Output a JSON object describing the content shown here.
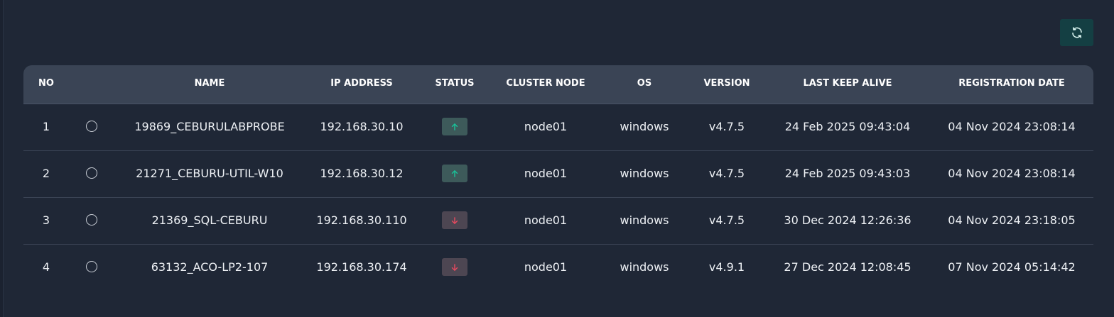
{
  "toolbar": {
    "refresh_icon": "refresh-icon",
    "accent": "#143f43"
  },
  "table": {
    "headers": {
      "no": "NO",
      "name": "NAME",
      "ip": "IP ADDRESS",
      "status": "STATUS",
      "cluster_node": "CLUSTER NODE",
      "os": "OS",
      "version": "VERSION",
      "last_keep_alive": "LAST KEEP ALIVE",
      "registration_date": "REGISTRATION DATE"
    },
    "rows": [
      {
        "no": "1",
        "name": "19869_CEBURULABPROBE",
        "ip": "192.168.30.10",
        "status": "up",
        "cluster_node": "node01",
        "os": "windows",
        "version": "v4.7.5",
        "last_keep_alive": "24 Feb 2025 09:43:04",
        "registration_date": "04 Nov 2024 23:08:14"
      },
      {
        "no": "2",
        "name": "21271_CEBURU-UTIL-W10",
        "ip": "192.168.30.12",
        "status": "up",
        "cluster_node": "node01",
        "os": "windows",
        "version": "v4.7.5",
        "last_keep_alive": "24 Feb 2025 09:43:03",
        "registration_date": "04 Nov 2024 23:08:14"
      },
      {
        "no": "3",
        "name": "21369_SQL-CEBURU",
        "ip": "192.168.30.110",
        "status": "down",
        "cluster_node": "node01",
        "os": "windows",
        "version": "v4.7.5",
        "last_keep_alive": "30 Dec 2024 12:26:36",
        "registration_date": "04 Nov 2024 23:18:05"
      },
      {
        "no": "4",
        "name": "63132_ACO-LP2-107",
        "ip": "192.168.30.174",
        "status": "down",
        "cluster_node": "node01",
        "os": "windows",
        "version": "v4.9.1",
        "last_keep_alive": "27 Dec 2024 12:08:45",
        "registration_date": "07 Nov 2024 05:14:42"
      }
    ]
  },
  "colors": {
    "status_up": "#19c39a",
    "status_down": "#e8495f",
    "header_bg": "#3a4455",
    "panel_bg": "#1f2736"
  }
}
